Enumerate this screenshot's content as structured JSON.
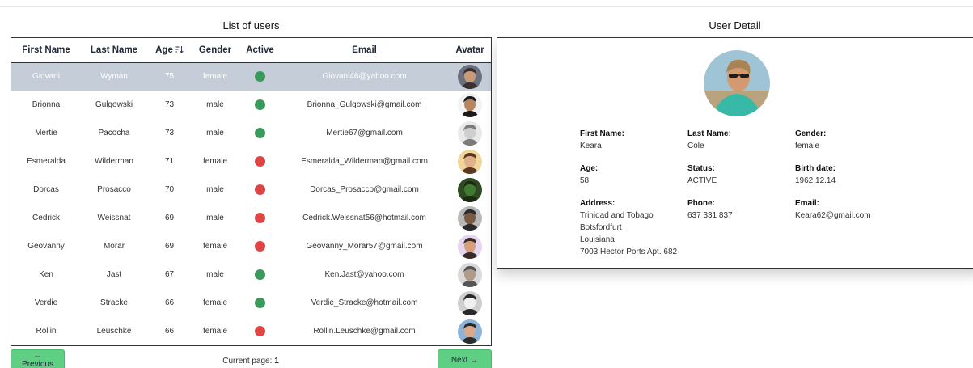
{
  "users_panel": {
    "title": "List of users",
    "columns": [
      "First Name",
      "Last Name",
      "Age",
      "Gender",
      "Active",
      "Email",
      "Avatar"
    ],
    "rows": [
      {
        "first": "Giovani",
        "last": "Wyman",
        "age": "75",
        "gender": "female",
        "active": true,
        "email": "Giovani48@yahoo.com",
        "selected": true
      },
      {
        "first": "Brionna",
        "last": "Gulgowski",
        "age": "73",
        "gender": "male",
        "active": true,
        "email": "Brionna_Gulgowski@gmail.com"
      },
      {
        "first": "Mertie",
        "last": "Pacocha",
        "age": "73",
        "gender": "male",
        "active": true,
        "email": "Mertie67@gmail.com"
      },
      {
        "first": "Esmeralda",
        "last": "Wilderman",
        "age": "71",
        "gender": "female",
        "active": false,
        "email": "Esmeralda_Wilderman@gmail.com"
      },
      {
        "first": "Dorcas",
        "last": "Prosacco",
        "age": "70",
        "gender": "male",
        "active": false,
        "email": "Dorcas_Prosacco@gmail.com"
      },
      {
        "first": "Cedrick",
        "last": "Weissnat",
        "age": "69",
        "gender": "male",
        "active": false,
        "email": "Cedrick.Weissnat56@hotmail.com"
      },
      {
        "first": "Geovanny",
        "last": "Morar",
        "age": "69",
        "gender": "female",
        "active": false,
        "email": "Geovanny_Morar57@gmail.com"
      },
      {
        "first": "Ken",
        "last": "Jast",
        "age": "67",
        "gender": "male",
        "active": true,
        "email": "Ken.Jast@yahoo.com"
      },
      {
        "first": "Verdie",
        "last": "Stracke",
        "age": "66",
        "gender": "female",
        "active": true,
        "email": "Verdie_Stracke@hotmail.com"
      },
      {
        "first": "Rollin",
        "last": "Leuschke",
        "age": "66",
        "gender": "female",
        "active": false,
        "email": "Rollin.Leuschke@gmail.com"
      }
    ],
    "active_color_on": "#3a9a5c",
    "active_color_off": "#e04545",
    "sort_icon": "sort-descending-icon"
  },
  "pagination": {
    "prev_label": "← Previous",
    "next_label": "Next →",
    "current_label": "Current page:",
    "current_page": "1"
  },
  "detail_panel": {
    "title": "User Detail",
    "first_name_label": "First Name:",
    "first_name": "Keara",
    "last_name_label": "Last Name:",
    "last_name": "Cole",
    "gender_label": "Gender:",
    "gender": "female",
    "age_label": "Age:",
    "age": "58",
    "status_label": "Status:",
    "status": "ACTIVE",
    "birth_label": "Birth date:",
    "birth": "1962.12.14",
    "address_label": "Address:",
    "address_lines": [
      "Trinidad and Tobago",
      "Botsfordfurt",
      "Louisiana",
      "7003 Hector Ports Apt. 682"
    ],
    "phone_label": "Phone:",
    "phone": "637 331 837",
    "email_label": "Email:",
    "email": "Keara62@gmail.com"
  }
}
